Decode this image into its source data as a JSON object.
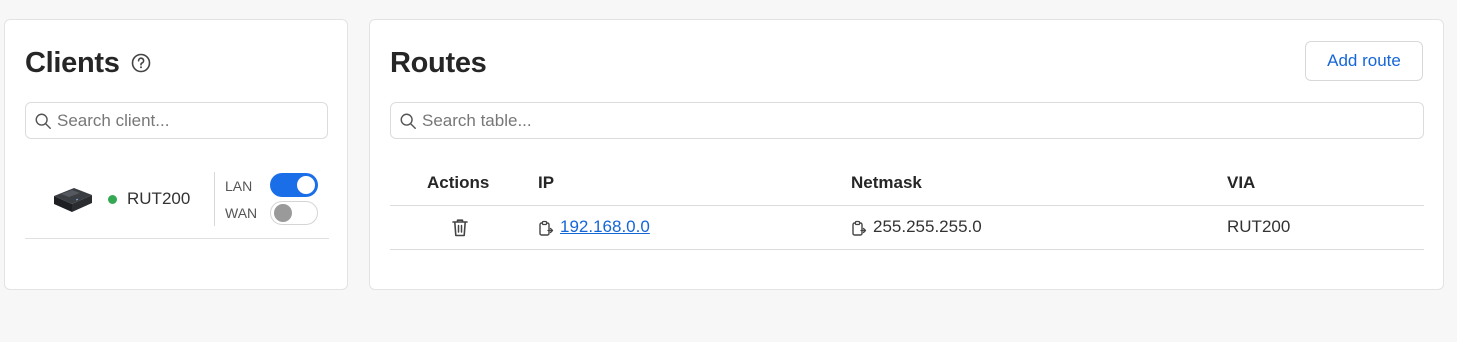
{
  "clients": {
    "title": "Clients",
    "help_icon": "question-circle-icon",
    "search_placeholder": "Search client...",
    "items": [
      {
        "name": "RUT200",
        "status": "online",
        "status_color": "#34a853",
        "interfaces": [
          {
            "label": "LAN",
            "enabled": true
          },
          {
            "label": "WAN",
            "enabled": false
          }
        ]
      }
    ]
  },
  "routes": {
    "title": "Routes",
    "add_button": "Add route",
    "search_placeholder": "Search table...",
    "columns": [
      "Actions",
      "IP",
      "Netmask",
      "VIA"
    ],
    "rows": [
      {
        "ip": "192.168.0.0",
        "netmask": "255.255.255.0",
        "via": "RUT200",
        "action_icon": "trash-icon"
      }
    ]
  },
  "colors": {
    "accent": "#1a6fe8",
    "link": "#1566d6",
    "online": "#34a853"
  }
}
